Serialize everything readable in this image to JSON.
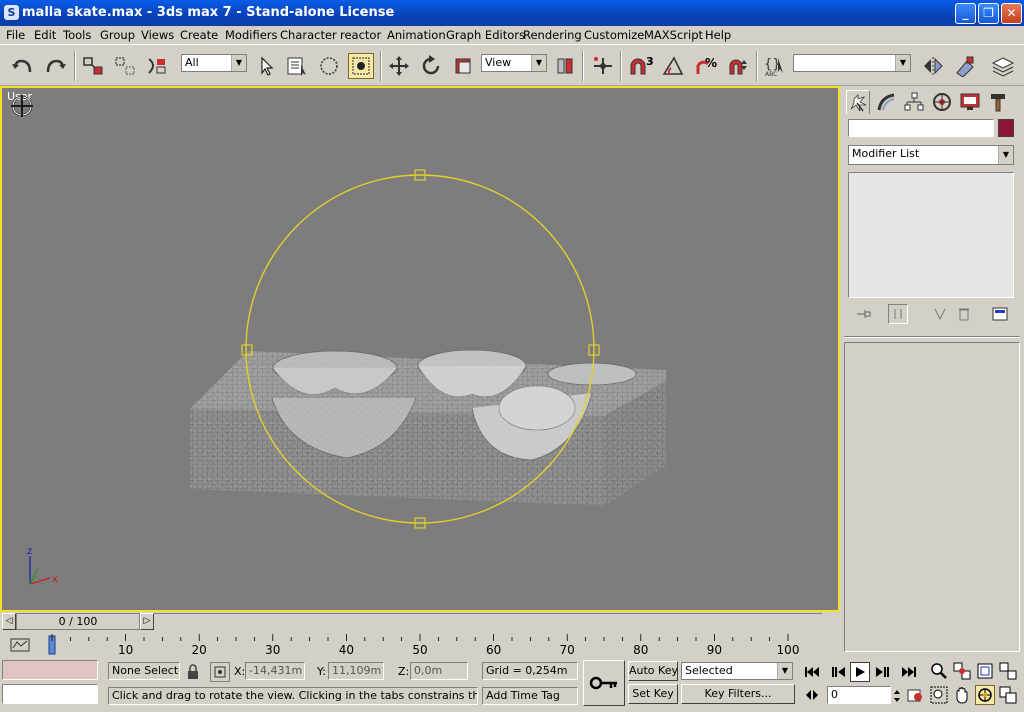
{
  "window": {
    "title": "malla skate.max - 3ds max 7  - Stand-alone License",
    "app_icon": "3ds-max-logo-icon",
    "controls": [
      "minimize-icon",
      "restore-icon",
      "close-icon"
    ]
  },
  "menu": {
    "items": [
      "File",
      "Edit",
      "Tools",
      "Group",
      "Views",
      "Create",
      "Modifiers",
      "Character",
      "reactor",
      "Animation",
      "Graph Editors",
      "Rendering",
      "Customize",
      "MAXScript",
      "Help"
    ]
  },
  "toolbar": {
    "selection_filter": "All",
    "reference_coord": "View",
    "snap_value": "3",
    "named_selection": ""
  },
  "viewport": {
    "label": "User",
    "axis_z": "z",
    "axis_x": "x",
    "background": "#7d7d7d",
    "border_color": "#f2de2e",
    "gizmo_color": "#e0d02a"
  },
  "command_panel": {
    "object_name": "",
    "object_color": "#8a1538",
    "modifier_list": "Modifier List"
  },
  "timeline": {
    "frame_label": "0 / 100",
    "ticks": [
      "0",
      "10",
      "20",
      "30",
      "40",
      "50",
      "60",
      "70",
      "80",
      "90",
      "100"
    ]
  },
  "status": {
    "selection": "None Selecte",
    "x_label": "X:",
    "x_value": "-14,431m",
    "y_label": "Y:",
    "y_value": "11,109m",
    "z_label": "Z:",
    "z_value": "0,0m",
    "grid": "Grid = 0,254m",
    "prompt": "Click and drag to rotate the view.  Clicking in the tabs constrains the rotation",
    "add_time_tag": "Add Time Tag",
    "auto_key": "Auto Key",
    "set_key": "Set Key",
    "key_mode": "Selected",
    "key_filters": "Key Filters...",
    "current_frame": "0"
  }
}
